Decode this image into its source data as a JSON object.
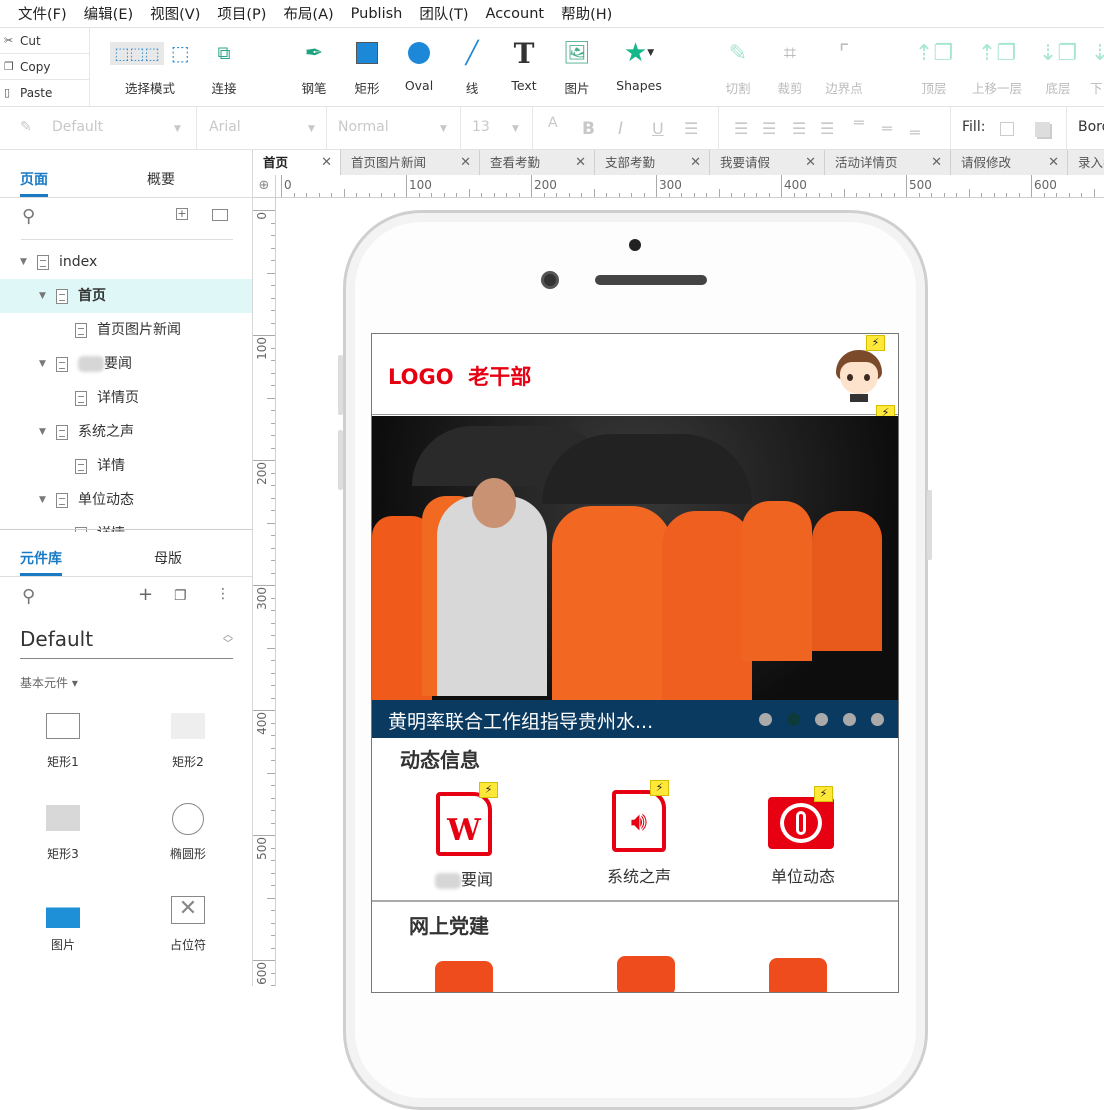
{
  "menu": [
    "文件(F)",
    "编辑(E)",
    "视图(V)",
    "项目(P)",
    "布局(A)",
    "Publish",
    "团队(T)",
    "Account",
    "帮助(H)"
  ],
  "clipboard": {
    "cut": "Cut",
    "copy": "Copy",
    "paste": "Paste"
  },
  "tools": {
    "select": "选择模式",
    "connect": "连接",
    "pen": "钢笔",
    "rect": "矩形",
    "oval": "Oval",
    "line": "线",
    "text": "Text",
    "image": "图片",
    "shapes": "Shapes",
    "slice": "切割",
    "crop": "裁剪",
    "points": "边界点",
    "top": "顶层",
    "forward": "上移一层",
    "bottom": "底层",
    "backward": "下"
  },
  "format": {
    "style": "Default",
    "font": "Arial",
    "weight": "Normal",
    "size": "13",
    "fill_label": "Fill:",
    "border_label": "Bord"
  },
  "left_panel": {
    "tabs": [
      "页面",
      "概要"
    ],
    "tree": [
      {
        "label": "index",
        "expanded": true
      },
      {
        "label": "首页",
        "expanded": true,
        "selected": true
      },
      {
        "label": "首页图片新闻"
      },
      {
        "label": "要闻",
        "expanded": true,
        "blurred_prefix": true
      },
      {
        "label": "详情页"
      },
      {
        "label": "系统之声",
        "expanded": true
      },
      {
        "label": "详情"
      },
      {
        "label": "单位动态",
        "expanded": true
      },
      {
        "label": "详情"
      }
    ],
    "lib_tabs": [
      "元件库",
      "母版"
    ],
    "library": "Default",
    "category": "基本元件 ▾",
    "widgets": [
      "矩形1",
      "矩形2",
      "矩形3",
      "椭圆形",
      "图片",
      "占位符"
    ]
  },
  "doc_tabs": [
    "首页",
    "首页图片新闻",
    "查看考勤",
    "支部考勤",
    "我要请假",
    "活动详情页",
    "请假修改",
    "录入考"
  ],
  "ruler_h": [
    "0",
    "100",
    "200",
    "300",
    "400",
    "500",
    "600"
  ],
  "ruler_v": [
    "0",
    "100",
    "200",
    "300",
    "400",
    "500",
    "600"
  ],
  "mobile": {
    "logo": "LOGO  老干部",
    "banner_caption": "黄明率联合工作组指导贵州水...",
    "carousel_active": 1,
    "carousel_count": 5,
    "section1": "动态信息",
    "items1": [
      "要闻",
      "系统之声",
      "单位动态"
    ],
    "section2": "网上党建",
    "interaction_icon": "lightning-icon"
  },
  "colors": {
    "accent": "#1a7bc4",
    "brand_red": "#e60012",
    "caption_bg": "#0b3a60",
    "party_orange": "#ee4c1c"
  }
}
